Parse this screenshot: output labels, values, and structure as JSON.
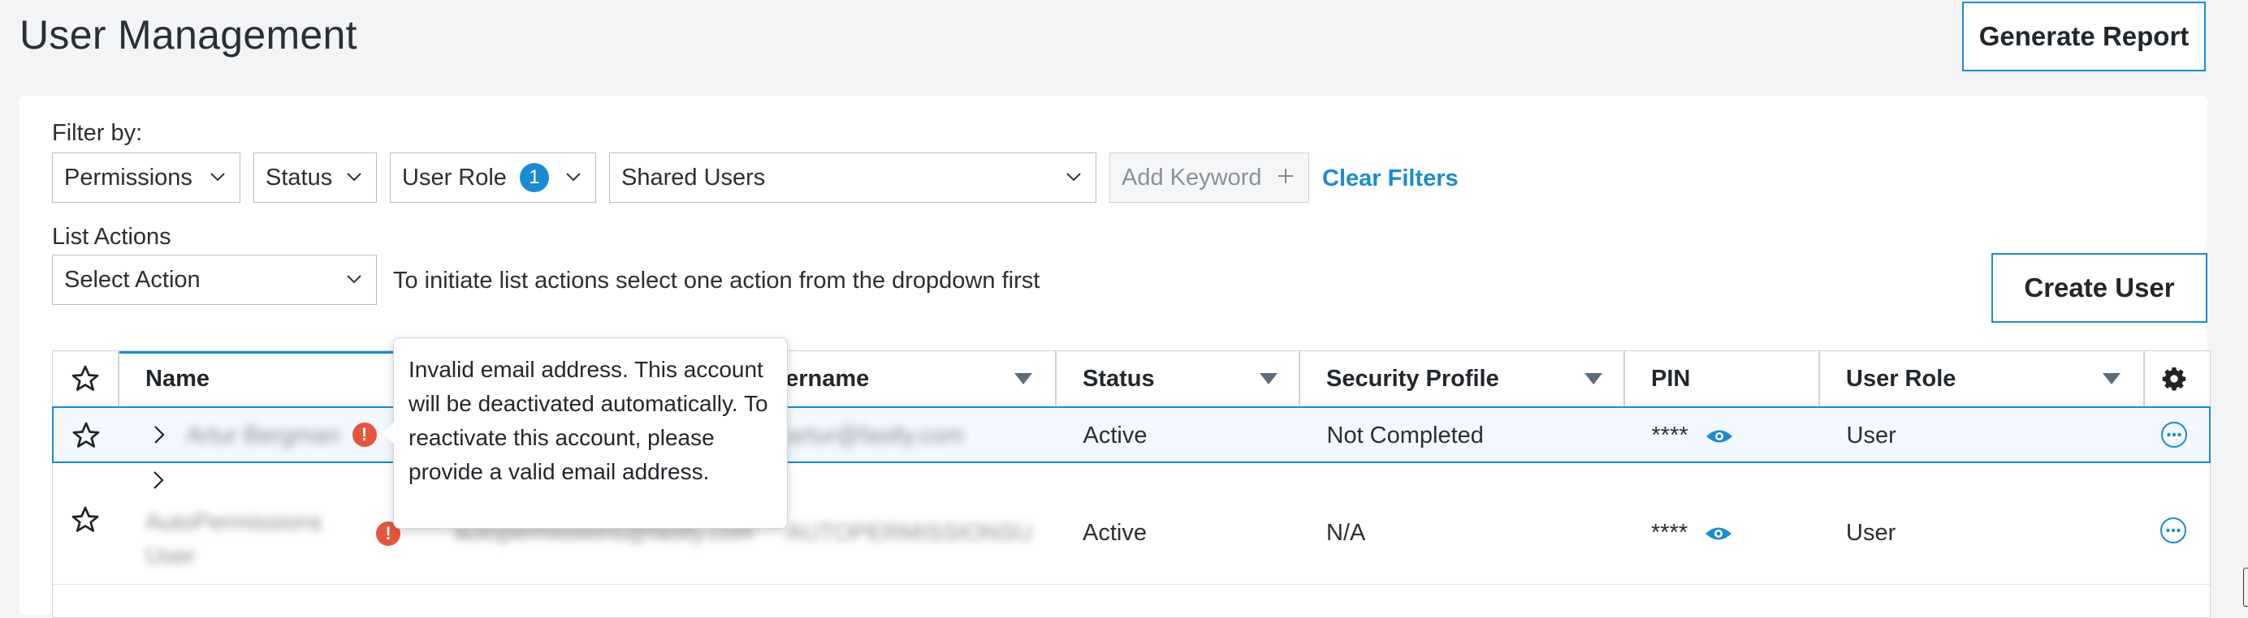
{
  "page": {
    "title": "User Management",
    "generate_report": "Generate Report"
  },
  "filters": {
    "label": "Filter by:",
    "permissions": "Permissions",
    "status": "Status",
    "user_role": "User Role",
    "user_role_count": "1",
    "shared_users": "Shared Users",
    "keyword_placeholder": "Add Keyword",
    "clear": "Clear Filters"
  },
  "list_actions": {
    "label": "List Actions",
    "select": "Select Action",
    "hint": "To initiate list actions select one action from the dropdown first",
    "create_user": "Create User"
  },
  "table": {
    "columns": [
      "Name",
      "Username",
      "Status",
      "Security Profile",
      "PIN",
      "User Role"
    ],
    "column_username_visible": "sername",
    "rows": [
      {
        "name": "Artur Bergman",
        "email": "",
        "username": "artur@fastly.com",
        "status": "Active",
        "security_profile": "Not Completed",
        "pin": "****",
        "user_role": "User"
      },
      {
        "name": "AutoPermissions User",
        "email": "autopermissions@fastly.com",
        "username": "AUTOPERMISSIONSUSER@F...",
        "status": "Active",
        "security_profile": "N/A",
        "pin": "****",
        "user_role": "User"
      }
    ]
  },
  "tooltip": {
    "text": "Invalid email address. This account will be deactivated automatically. To reactivate this account, please provide a valid email address."
  },
  "colors": {
    "accent": "#1a8bd1",
    "error": "#e8553e"
  }
}
